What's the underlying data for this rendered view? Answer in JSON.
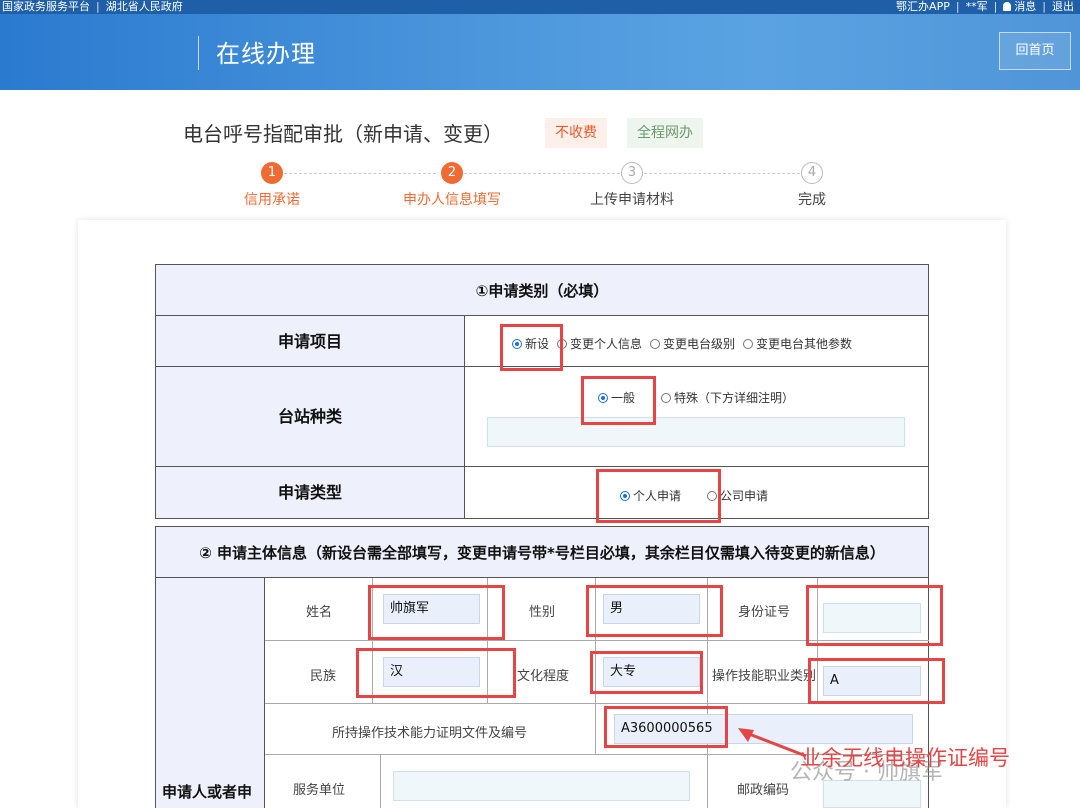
{
  "topbar": {
    "site": "国家政务服务平台",
    "province": "湖北省人民政府",
    "app": "鄂汇办APP",
    "user": "**军",
    "messages": "消息",
    "logout": "退出"
  },
  "banner": {
    "title": "在线办理",
    "home": "回首页"
  },
  "page": {
    "title": "电台呼号指配审批（新申请、变更）",
    "tag_fee": "不收费",
    "tag_online": "全程网办"
  },
  "steps": [
    {
      "num": "1",
      "label": "信用承诺",
      "state": "active"
    },
    {
      "num": "2",
      "label": "申办人信息填写",
      "state": "active"
    },
    {
      "num": "3",
      "label": "上传申请材料",
      "state": "todo"
    },
    {
      "num": "4",
      "label": "完成",
      "state": "todo"
    }
  ],
  "section1": {
    "title": "①申请类别（必填）",
    "apply_item": {
      "label": "申请项目",
      "options": [
        "新设",
        "变更个人信息",
        "变更电台级别",
        "变更电台其他参数"
      ],
      "selected": "新设"
    },
    "station_type": {
      "label": "台站种类",
      "options": [
        "一般",
        "特殊（下方详细注明）"
      ],
      "selected": "一般",
      "note": ""
    },
    "apply_type": {
      "label": "申请类型",
      "options": [
        "个人申请",
        "公司申请"
      ],
      "selected": "个人申请"
    }
  },
  "section2": {
    "title": "② 申请主体信息（新设台需全部填写，变更申请号带*号栏目必填，其余栏目仅需填入待变更的新信息）",
    "side_label": "申请人或者申",
    "name_label": "姓名",
    "name_value": "帅旗军",
    "gender_label": "性别",
    "gender_value": "男",
    "id_label": "身份证号",
    "id_value": "",
    "ethnic_label": "民族",
    "ethnic_value": "汉",
    "edu_label": "文化程度",
    "edu_value": "大专",
    "skill_label": "操作技能职业类别",
    "skill_value": "A",
    "cert_label": "所持操作技术能力证明文件及编号",
    "cert_value": "A3600000565",
    "unit_label": "服务单位",
    "unit_value": "",
    "postcode_label": "邮政编码",
    "postcode_value": ""
  },
  "annotation": {
    "text": "业余无线电操作证编号",
    "watermark": "公众号 · 帅旗军"
  },
  "colors": {
    "accent": "#ef6b33",
    "highlight": "#e64545",
    "banner": "#3b8bd6"
  }
}
